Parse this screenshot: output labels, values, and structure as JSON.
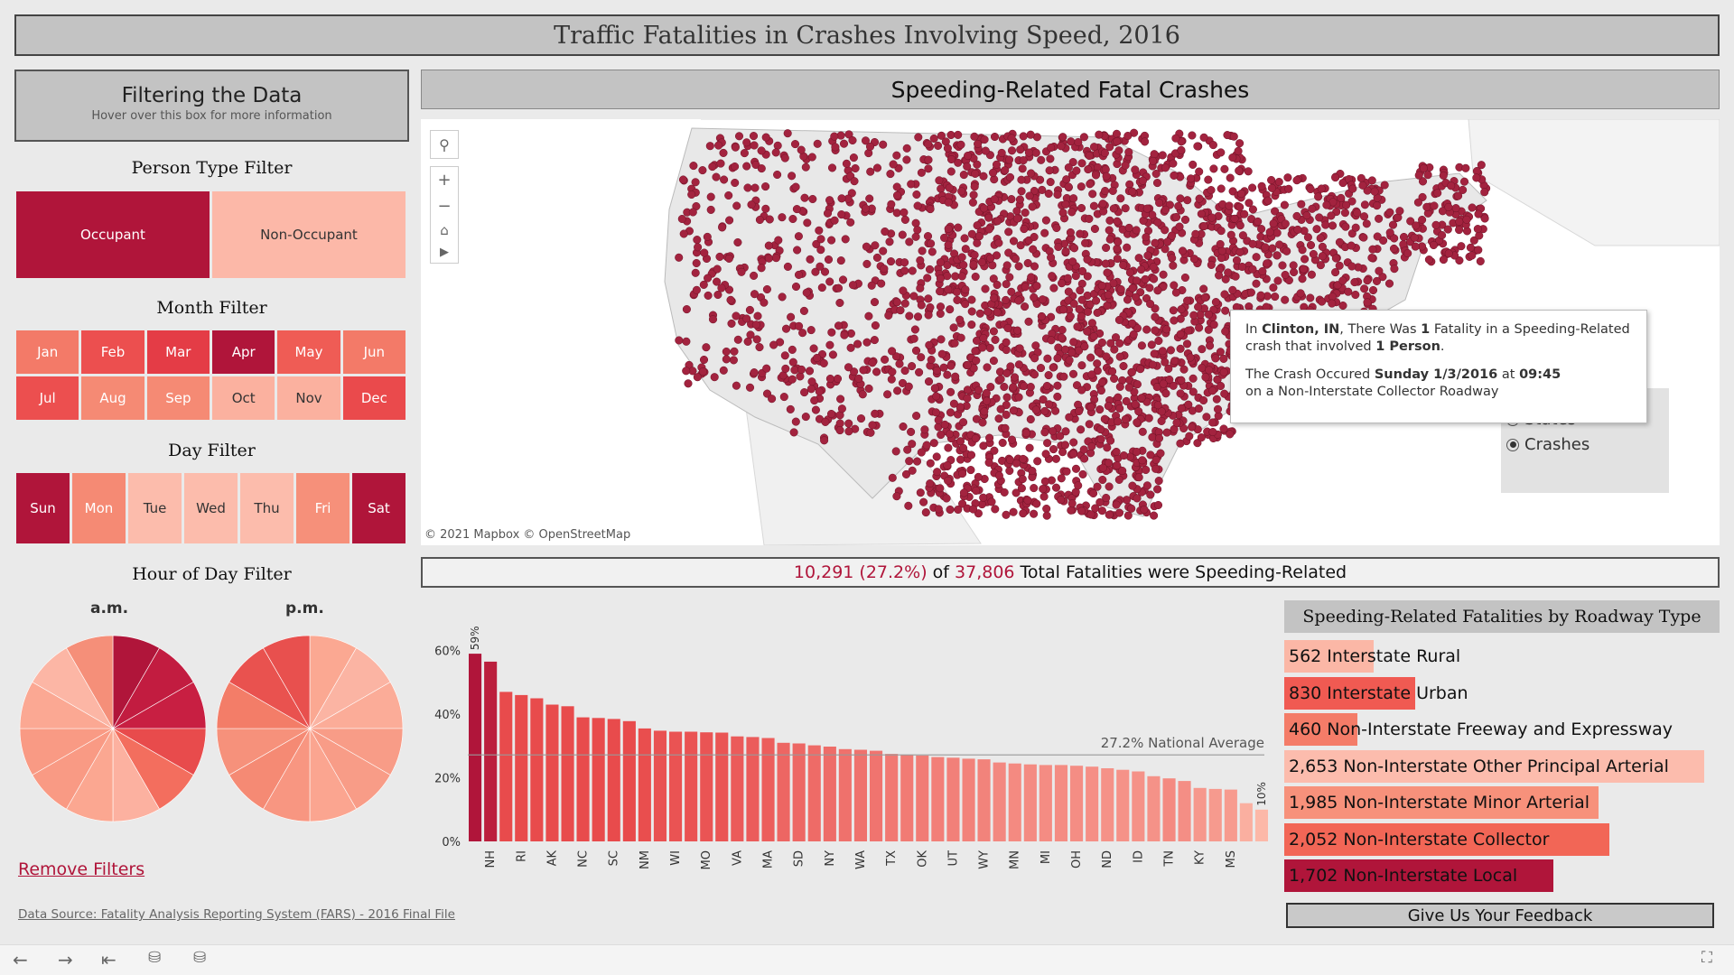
{
  "title": "Traffic Fatalities in Crashes Involving Speed, 2016",
  "filter_box": {
    "title": "Filtering the Data",
    "subtitle": "Hover over this box for more information"
  },
  "person_filter": {
    "title": "Person Type Filter",
    "items": [
      {
        "label": "Occupant",
        "color": "#b0153a"
      },
      {
        "label": "Non-Occupant",
        "color": "#fcb8a8"
      }
    ]
  },
  "month_filter": {
    "title": "Month Filter",
    "items": [
      {
        "label": "Jan",
        "color": "#f37a68"
      },
      {
        "label": "Feb",
        "color": "#ec4f4f"
      },
      {
        "label": "Mar",
        "color": "#e43c46"
      },
      {
        "label": "Apr",
        "color": "#b0153a"
      },
      {
        "label": "May",
        "color": "#ef5c55"
      },
      {
        "label": "Jun",
        "color": "#f37a68"
      },
      {
        "label": "Jul",
        "color": "#ec4f4f"
      },
      {
        "label": "Aug",
        "color": "#f58a74"
      },
      {
        "label": "Sep",
        "color": "#f58a74"
      },
      {
        "label": "Oct",
        "color": "#fbb19f"
      },
      {
        "label": "Nov",
        "color": "#fbb19f"
      },
      {
        "label": "Dec",
        "color": "#ea4a4c"
      }
    ]
  },
  "day_filter": {
    "title": "Day Filter",
    "items": [
      {
        "label": "Sun",
        "color": "#b0153a"
      },
      {
        "label": "Mon",
        "color": "#f58a74"
      },
      {
        "label": "Tue",
        "color": "#fcbcac"
      },
      {
        "label": "Wed",
        "color": "#fcbcac"
      },
      {
        "label": "Thu",
        "color": "#fcbcac"
      },
      {
        "label": "Fri",
        "color": "#f6907a"
      },
      {
        "label": "Sat",
        "color": "#b0153a"
      }
    ]
  },
  "hour_filter": {
    "title": "Hour of Day Filter",
    "am_label": "a.m.",
    "pm_label": "p.m.",
    "am_colors": [
      "#b0153a",
      "#c21c40",
      "#c81f42",
      "#e84b4c",
      "#f36e5e",
      "#fcb1a0",
      "#fba791",
      "#f99a84",
      "#f99a84",
      "#fba893",
      "#fcb6a5",
      "#f58f79"
    ],
    "pm_colors": [
      "#fba892",
      "#fbb4a3",
      "#fbac98",
      "#f89c87",
      "#f89c87",
      "#fba590",
      "#f89681",
      "#f58a74",
      "#f6917b",
      "#f37d68",
      "#e9524f",
      "#e8504e"
    ]
  },
  "remove_filters": "Remove Filters",
  "data_source": "Data Source: Fatality Analysis Reporting System (FARS) - 2016 Final File",
  "map": {
    "title": "Speeding-Related Fatal Crashes",
    "attribution": "© 2021 Mapbox  © OpenStreetMap",
    "icons": [
      "search-icon",
      "zoom-in-icon",
      "zoom-out-icon",
      "home-icon",
      "play-icon"
    ],
    "dot_color": "#a3233f",
    "tooltip": {
      "line1_pre": "In ",
      "city": "Clinton, IN",
      "line1_mid": ", There Was ",
      "count": "1",
      "line1_post": " Fatality in a Speeding-Related",
      "line2_pre": "crash that involved ",
      "persons": "1 Person",
      "line2_post": ".",
      "line3_pre": "The Crash Occured ",
      "date": "Sunday 1/3/2016",
      "line3_mid": " at ",
      "time": "09:45",
      "line4": "on a Non-Interstate Collector Roadway"
    },
    "toggle": {
      "option1": "States",
      "option2": "Crashes",
      "selected": "Crashes"
    }
  },
  "summary": {
    "speeding": "10,291",
    "pct": "(27.2%)",
    "of": " of ",
    "total": "37,806",
    "suffix": " Total Fatalities were Speeding-Related"
  },
  "chart_data": {
    "type": "bar",
    "title": "",
    "xlabel": "",
    "ylabel": "",
    "ylim": [
      0,
      65
    ],
    "yticks": [
      "60%",
      "40%",
      "20%",
      "0%"
    ],
    "ytick_values": [
      60,
      40,
      20,
      0
    ],
    "categories": [
      "",
      "NH",
      "",
      "RI",
      "",
      "AK",
      "",
      "NC",
      "",
      "SC",
      "",
      "NM",
      "",
      "WI",
      "",
      "MO",
      "",
      "VA",
      "",
      "MA",
      "",
      "SD",
      "",
      "NY",
      "",
      "WA",
      "",
      "TX",
      "",
      "OK",
      "",
      "UT",
      "",
      "WY",
      "",
      "MN",
      "",
      "MI",
      "",
      "OH",
      "",
      "ND",
      "",
      "ID",
      "",
      "TN",
      "",
      "KY",
      "",
      "MS",
      ""
    ],
    "values": [
      59,
      56.5,
      47,
      46,
      45,
      43,
      42.5,
      39,
      38.8,
      38.5,
      37.8,
      35.5,
      34.8,
      34.5,
      34.5,
      34.3,
      34.2,
      33,
      32.8,
      32.5,
      31,
      30.8,
      30.2,
      29.8,
      29,
      28.8,
      28.5,
      27.5,
      27.2,
      27,
      26.5,
      26.3,
      26,
      25.8,
      24.8,
      24.5,
      24.2,
      24,
      24,
      23.8,
      23.5,
      23,
      22.5,
      22,
      20.5,
      19.8,
      19,
      16.8,
      16.5,
      16.3,
      12,
      10
    ],
    "bar_labels": {
      "first": "59%",
      "last": "10%"
    },
    "reference_line": {
      "value": 27.2,
      "label": "27.2% National Average"
    },
    "colors": {
      "high": "#b0153a",
      "mid": "#e84b4c",
      "low": "#fcb8a8"
    }
  },
  "roadway": {
    "title": "Speeding-Related Fatalities by Roadway Type",
    "max": 2653,
    "items": [
      {
        "label": "562 Interstate Rural",
        "value": 562,
        "color": "#fbb7a6"
      },
      {
        "label": "830 Interstate Urban",
        "value": 830,
        "color": "#f05a52"
      },
      {
        "label": "460 Non-Interstate Freeway and Expressway",
        "value": 460,
        "color": "#f47c68"
      },
      {
        "label": "2,653 Non-Interstate Other Principal Arterial",
        "value": 2653,
        "color": "#fcbcad"
      },
      {
        "label": "1,985 Non-Interstate Minor Arterial",
        "value": 1985,
        "color": "#f7917b"
      },
      {
        "label": "2,052 Non-Interstate Collector",
        "value": 2052,
        "color": "#f26656"
      },
      {
        "label": "1,702 Non-Interstate Local",
        "value": 1702,
        "color": "#b0153a"
      }
    ]
  },
  "feedback": "Give Us Your Feedback",
  "toolbar_icons": [
    "back-icon",
    "forward-icon",
    "first-icon",
    "revert-icon",
    "refresh-icon",
    "fullscreen-icon"
  ]
}
